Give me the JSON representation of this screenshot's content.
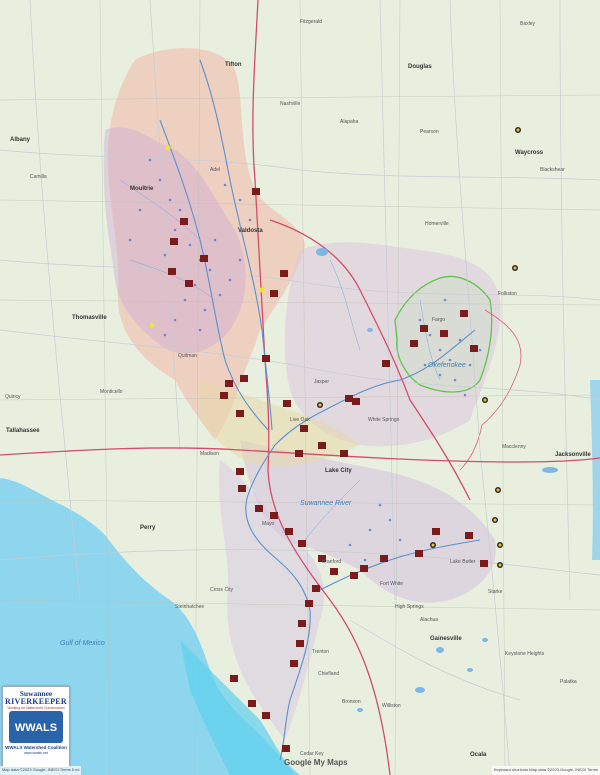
{
  "map": {
    "colors": {
      "land": "#e8eedd",
      "watershed": "#f1c9b8",
      "watershed2": "#d9c5d6",
      "gulf": "#7fd3ee",
      "river": "#5b8fd0",
      "interstate": "#d44c6a",
      "outline": "#4fb84a",
      "marker": "#7a1c1c"
    },
    "labels": {
      "albany": "Albany",
      "valdosta": "Valdosta",
      "tallahassee": "Tallahassee",
      "jacksonville": "Jacksonville",
      "gainesville": "Gainesville",
      "lake_city": "Lake City",
      "live_oak": "Live Oak",
      "madison": "Madison",
      "perry": "Perry",
      "tifton": "Tifton",
      "waycross": "Waycross",
      "moultrie": "Moultrie",
      "thomasville": "Thomasville",
      "quitman": "Quitman",
      "homerville": "Homerville",
      "fargo": "Fargo",
      "douglas": "Douglas",
      "nashville": "Nashville",
      "adel": "Adel",
      "jasper": "Jasper",
      "white_springs": "White Springs",
      "mayo": "Mayo",
      "branford": "Branford",
      "fort_white": "Fort White",
      "high_springs": "High Springs",
      "alachua": "Alachua",
      "lake_butler": "Lake Butler",
      "starke": "Starke",
      "macclenny": "Macclenny",
      "folkston": "Folkston",
      "baxley": "Baxley",
      "cross_city": "Cross City",
      "trenton": "Trenton",
      "chiefland": "Chiefland",
      "bronson": "Bronson",
      "williston": "Williston",
      "ocala": "Ocala",
      "cedar_key": "Cedar Key",
      "steinhatchee": "Steinhatchee",
      "monticello": "Monticello",
      "quincy": "Quincy",
      "camilla": "Camilla",
      "fitzgerald": "Fitzgerald",
      "alapaha": "Alapaha",
      "pearson": "Pearson",
      "blackshear": "Blackshear",
      "keystone_heights": "Keystone Heights",
      "palatka": "Palatka"
    },
    "water_labels": {
      "gulf": "Gulf of Mexico",
      "suwannee": "Suwannee River",
      "okefenokee": "Okefenokee"
    },
    "logo": {
      "line1": "Suwannee",
      "line2": "RIVERKEEPER",
      "line3": "Working for Watershed Conservation",
      "badge": "WWALS",
      "line4": "WWALS Watershed Coalition",
      "line5": "www.wwals.net"
    },
    "attribution": {
      "left": "Map data ©2023 Google, INEGI   Terms   5 mi",
      "right": "Keyboard shortcuts   Map data ©2023 Google, INEGI   Terms",
      "google": "Google My Maps"
    }
  }
}
